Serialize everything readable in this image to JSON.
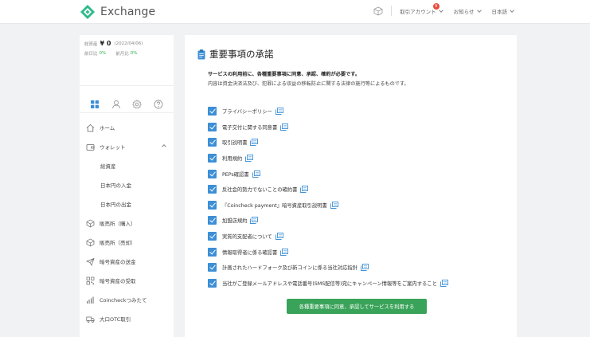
{
  "header": {
    "brand": "Exchange",
    "notice_count": "9",
    "menu": [
      {
        "label": "取引アカウント"
      },
      {
        "label": "お知らせ"
      },
      {
        "label": "日本語"
      }
    ],
    "colors": {
      "brand_green": "#2fb98a",
      "badge": "#e84c3d"
    }
  },
  "sidebar": {
    "balance": {
      "total_label": "総資産",
      "total_value": "¥ 0",
      "date": "(2022/04/06)",
      "prev_day_label": "前日比",
      "prev_day_value": "0%",
      "prev_month_label": "前月比",
      "prev_month_value": "0%"
    },
    "tabs": [
      "grid-icon",
      "user-icon",
      "gear-icon",
      "help-icon"
    ],
    "nav": [
      {
        "label": "ホーム",
        "icon": "home-icon"
      },
      {
        "label": "ウォレット",
        "icon": "wallet-icon"
      },
      {
        "label": "総資産"
      },
      {
        "label": "日本円の入金"
      },
      {
        "label": "日本円の出金"
      },
      {
        "label": "販売所（購入）",
        "icon": "buy-icon"
      },
      {
        "label": "販売所（売却）",
        "icon": "sell-icon"
      },
      {
        "label": "暗号資産の送金",
        "icon": "send-icon"
      },
      {
        "label": "暗号資産の受取",
        "icon": "qr-icon"
      },
      {
        "label": "Coincheckつみたて",
        "icon": "chart-icon"
      },
      {
        "label": "大口OTC取引",
        "icon": "truck-icon"
      }
    ]
  },
  "main": {
    "title": "重要事項の承諾",
    "intro_bold": "サービスの利用前に、各種重要事項に同意、承認、確約が必要です。",
    "intro_text": "内容は資金決済法及び、犯罪による収益の移転防止に関する法律の施行等によるものです。",
    "documents": [
      {
        "label": "プライバシーポリシー",
        "checked": true
      },
      {
        "label": "電子交付に関する同意書",
        "checked": true
      },
      {
        "label": "取引説明書",
        "checked": true
      },
      {
        "label": "利用規約",
        "checked": true
      },
      {
        "label": "PEPs確認書",
        "checked": true
      },
      {
        "label": "反社会的勢力でないことの確約書",
        "checked": true
      },
      {
        "label": "『Coincheck payment』暗号資産取引説明書",
        "checked": true
      },
      {
        "label": "加盟店規約",
        "checked": true
      },
      {
        "label": "実質的支配者について",
        "checked": true
      },
      {
        "label": "情報取得者に係る確認書",
        "checked": true
      },
      {
        "label": "計画されたハードフォーク及び新コインに係る当社対応指針",
        "checked": true
      },
      {
        "label": "当社がご登録メールアドレスや電話番号(SMS配信等)宛にキャンペーン情報等をご案内すること",
        "checked": true
      }
    ],
    "agree_button": "各種重要事項に同意、承認してサービスを利用する",
    "colors": {
      "checkbox": "#3d8fd6",
      "button": "#3aa35a"
    }
  }
}
